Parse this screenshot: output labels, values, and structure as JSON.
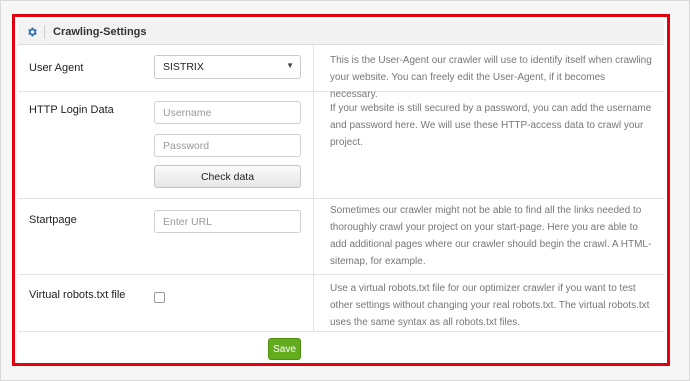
{
  "panel": {
    "title": "Crawling-Settings",
    "header_icon": "gear-icon"
  },
  "user_agent": {
    "label": "User Agent",
    "selected": "SISTRIX",
    "description": "This is the User-Agent our crawler will use to identify itself when crawling your website. You can freely edit the User-Agent, if it becomes necessary."
  },
  "http_login": {
    "label": "HTTP Login Data",
    "username_placeholder": "Username",
    "password_placeholder": "Password",
    "check_button": "Check data",
    "description": "If your website is still secured by a password, you can add the username and password here. We will use these HTTP-access data to crawl your project."
  },
  "startpage": {
    "label": "Startpage",
    "url_placeholder": "Enter URL",
    "description": "Sometimes our crawler might not be able to find all the links needed to thoroughly crawl your project on your start-page. Here you are able to add additional pages where our crawler should begin the crawl. A HTML-sitemap, for example."
  },
  "robots": {
    "label": "Virtual robots.txt file",
    "checked": false,
    "description": "Use a virtual robots.txt file for our optimizer crawler if you want to test other settings without changing your real robots.txt. The virtual robots.txt uses the same syntax as all robots.txt files."
  },
  "save_label": "Save",
  "colors": {
    "highlight_border": "#e3000f",
    "save_button": "#63ad1d",
    "gear_icon": "#2a6db5"
  }
}
